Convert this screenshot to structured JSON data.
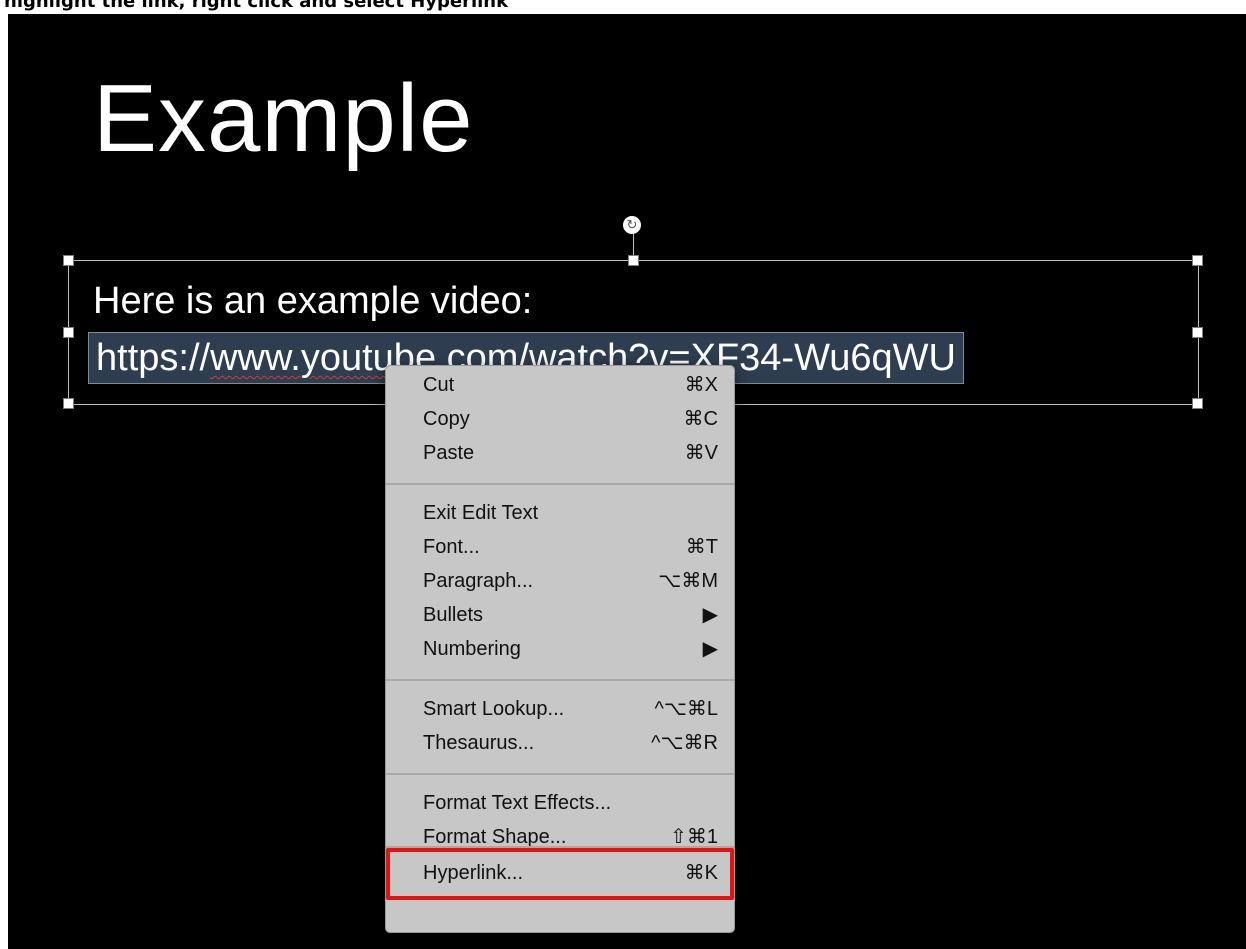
{
  "caption": "highlight the link, right click and select Hyperlink",
  "slide": {
    "title": "Example",
    "line1": "Here is an example video:",
    "url_parts": [
      "https://",
      "www.youtube",
      ".com/",
      "watch",
      "?",
      "v",
      "=XF34-Wu6qWU"
    ],
    "rotate_glyph": "↻"
  },
  "context_menu": {
    "items": [
      {
        "label": "Cut",
        "shortcut": "⌘X"
      },
      {
        "label": "Copy",
        "shortcut": "⌘C"
      },
      {
        "label": "Paste",
        "shortcut": "⌘V"
      },
      {
        "label": "Exit Edit Text",
        "shortcut": ""
      },
      {
        "label": "Font...",
        "shortcut": "⌘T"
      },
      {
        "label": "Paragraph...",
        "shortcut": "⌥⌘M"
      },
      {
        "label": "Bullets",
        "shortcut": "▶"
      },
      {
        "label": "Numbering",
        "shortcut": "▶"
      },
      {
        "label": "Smart Lookup...",
        "shortcut": "^⌥⌘L"
      },
      {
        "label": "Thesaurus...",
        "shortcut": "^⌥⌘R"
      },
      {
        "label": "Format Text Effects...",
        "shortcut": ""
      },
      {
        "label": "Format Shape...",
        "shortcut": "⇧⌘1"
      },
      {
        "label": "Hyperlink...",
        "shortcut": "⌘K"
      }
    ]
  },
  "colors": {
    "slide_bg": "#000000",
    "menu_bg": "#c7c7c7",
    "highlight_border": "#e3140f",
    "selection_bg": "#2e3d4f"
  }
}
